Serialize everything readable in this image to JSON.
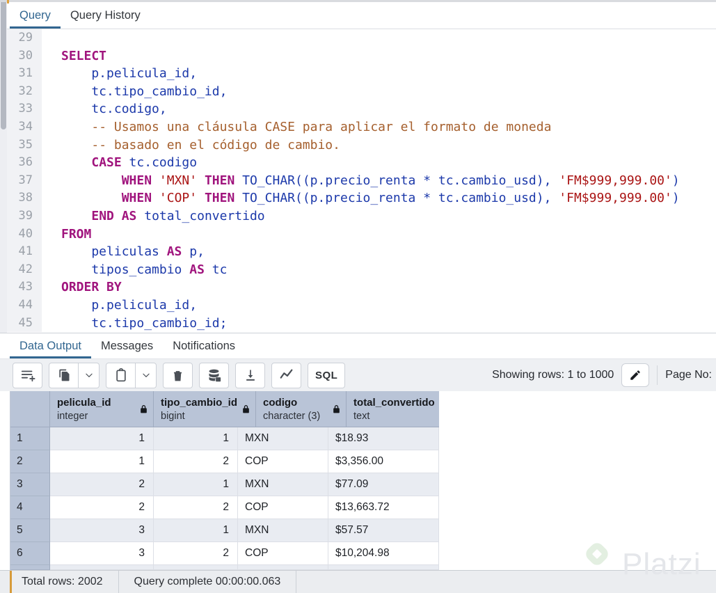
{
  "tabs": {
    "top": [
      {
        "label": "Query",
        "active": true
      },
      {
        "label": "Query History",
        "active": false
      }
    ],
    "output": [
      {
        "label": "Data Output",
        "active": true
      },
      {
        "label": "Messages",
        "active": false
      },
      {
        "label": "Notifications",
        "active": false
      }
    ]
  },
  "editor": {
    "lines": [
      {
        "n": "29",
        "segs": []
      },
      {
        "n": "30",
        "segs": [
          [
            "kw",
            "SELECT"
          ]
        ]
      },
      {
        "n": "31",
        "segs": [
          [
            "code",
            "    p.pelicula_id,"
          ]
        ]
      },
      {
        "n": "32",
        "segs": [
          [
            "code",
            "    tc.tipo_cambio_id,"
          ]
        ]
      },
      {
        "n": "33",
        "segs": [
          [
            "code",
            "    tc.codigo,"
          ]
        ]
      },
      {
        "n": "34",
        "segs": [
          [
            "code",
            "    "
          ],
          [
            "com",
            "-- Usamos una cláusula CASE para aplicar el formato de moneda"
          ]
        ]
      },
      {
        "n": "35",
        "segs": [
          [
            "code",
            "    "
          ],
          [
            "com",
            "-- basado en el código de cambio."
          ]
        ]
      },
      {
        "n": "36",
        "segs": [
          [
            "code",
            "    "
          ],
          [
            "kw",
            "CASE"
          ],
          [
            "code",
            " tc.codigo"
          ]
        ]
      },
      {
        "n": "37",
        "segs": [
          [
            "code",
            "        "
          ],
          [
            "kw",
            "WHEN"
          ],
          [
            "code",
            " "
          ],
          [
            "str",
            "'MXN'"
          ],
          [
            "code",
            " "
          ],
          [
            "kw",
            "THEN"
          ],
          [
            "code",
            " TO_CHAR((p.precio_renta * tc.cambio_usd), "
          ],
          [
            "str",
            "'FM$999,999.00'"
          ],
          [
            "code",
            ")"
          ]
        ]
      },
      {
        "n": "38",
        "segs": [
          [
            "code",
            "        "
          ],
          [
            "kw",
            "WHEN"
          ],
          [
            "code",
            " "
          ],
          [
            "str",
            "'COP'"
          ],
          [
            "code",
            " "
          ],
          [
            "kw",
            "THEN"
          ],
          [
            "code",
            " TO_CHAR((p.precio_renta * tc.cambio_usd), "
          ],
          [
            "str",
            "'FM$999,999.00'"
          ],
          [
            "code",
            ")"
          ]
        ]
      },
      {
        "n": "39",
        "segs": [
          [
            "code",
            "    "
          ],
          [
            "kw",
            "END"
          ],
          [
            "code",
            " "
          ],
          [
            "kw",
            "AS"
          ],
          [
            "code",
            " total_convertido"
          ]
        ]
      },
      {
        "n": "40",
        "segs": [
          [
            "kw",
            "FROM"
          ]
        ]
      },
      {
        "n": "41",
        "segs": [
          [
            "code",
            "    peliculas "
          ],
          [
            "kw",
            "AS"
          ],
          [
            "code",
            " p,"
          ]
        ]
      },
      {
        "n": "42",
        "segs": [
          [
            "code",
            "    tipos_cambio "
          ],
          [
            "kw",
            "AS"
          ],
          [
            "code",
            " tc"
          ]
        ]
      },
      {
        "n": "43",
        "segs": [
          [
            "kw",
            "ORDER BY"
          ]
        ]
      },
      {
        "n": "44",
        "segs": [
          [
            "code",
            "    p.pelicula_id,"
          ]
        ]
      },
      {
        "n": "45",
        "segs": [
          [
            "code",
            "    tc.tipo_cambio_id;"
          ]
        ]
      }
    ]
  },
  "toolbar": {
    "sql_label": "SQL",
    "showing_rows": "Showing rows: 1 to 1000",
    "page_no": "Page No:",
    "icons": [
      "add-row-icon",
      "copy-icon",
      "chevron-down-icon",
      "paste-icon",
      "chevron-down-icon",
      "delete-icon",
      "save-data-icon",
      "download-icon",
      "graph-icon",
      "sql-button",
      "edit-icon"
    ]
  },
  "grid": {
    "columns": [
      {
        "name": "pelicula_id",
        "type": "integer",
        "align": "right"
      },
      {
        "name": "tipo_cambio_id",
        "type": "bigint",
        "align": "right"
      },
      {
        "name": "codigo",
        "type": "character (3)",
        "align": "left"
      },
      {
        "name": "total_convertido",
        "type": "text",
        "align": "left"
      }
    ],
    "rows": [
      {
        "n": "1",
        "cells": [
          "1",
          "1",
          "MXN",
          "$18.93"
        ]
      },
      {
        "n": "2",
        "cells": [
          "1",
          "2",
          "COP",
          "$3,356.00"
        ]
      },
      {
        "n": "3",
        "cells": [
          "2",
          "1",
          "MXN",
          "$77.09"
        ]
      },
      {
        "n": "4",
        "cells": [
          "2",
          "2",
          "COP",
          "$13,663.72"
        ]
      },
      {
        "n": "5",
        "cells": [
          "3",
          "1",
          "MXN",
          "$57.57"
        ]
      },
      {
        "n": "6",
        "cells": [
          "3",
          "2",
          "COP",
          "$10,204.98"
        ]
      }
    ]
  },
  "statusbar": {
    "total_rows": "Total rows: 2002",
    "query_complete": "Query complete 00:00:00.063"
  },
  "watermark": {
    "brand": "Platzi"
  },
  "colors": {
    "accent_blue": "#326690",
    "keyword": "#a0147d",
    "identifier": "#1c39aa",
    "comment": "#a55f2d",
    "string": "#aa1414",
    "header_bg": "#b9c4d7",
    "row_alt_bg": "#e9ecf2",
    "status_accent": "#d79b3a"
  }
}
